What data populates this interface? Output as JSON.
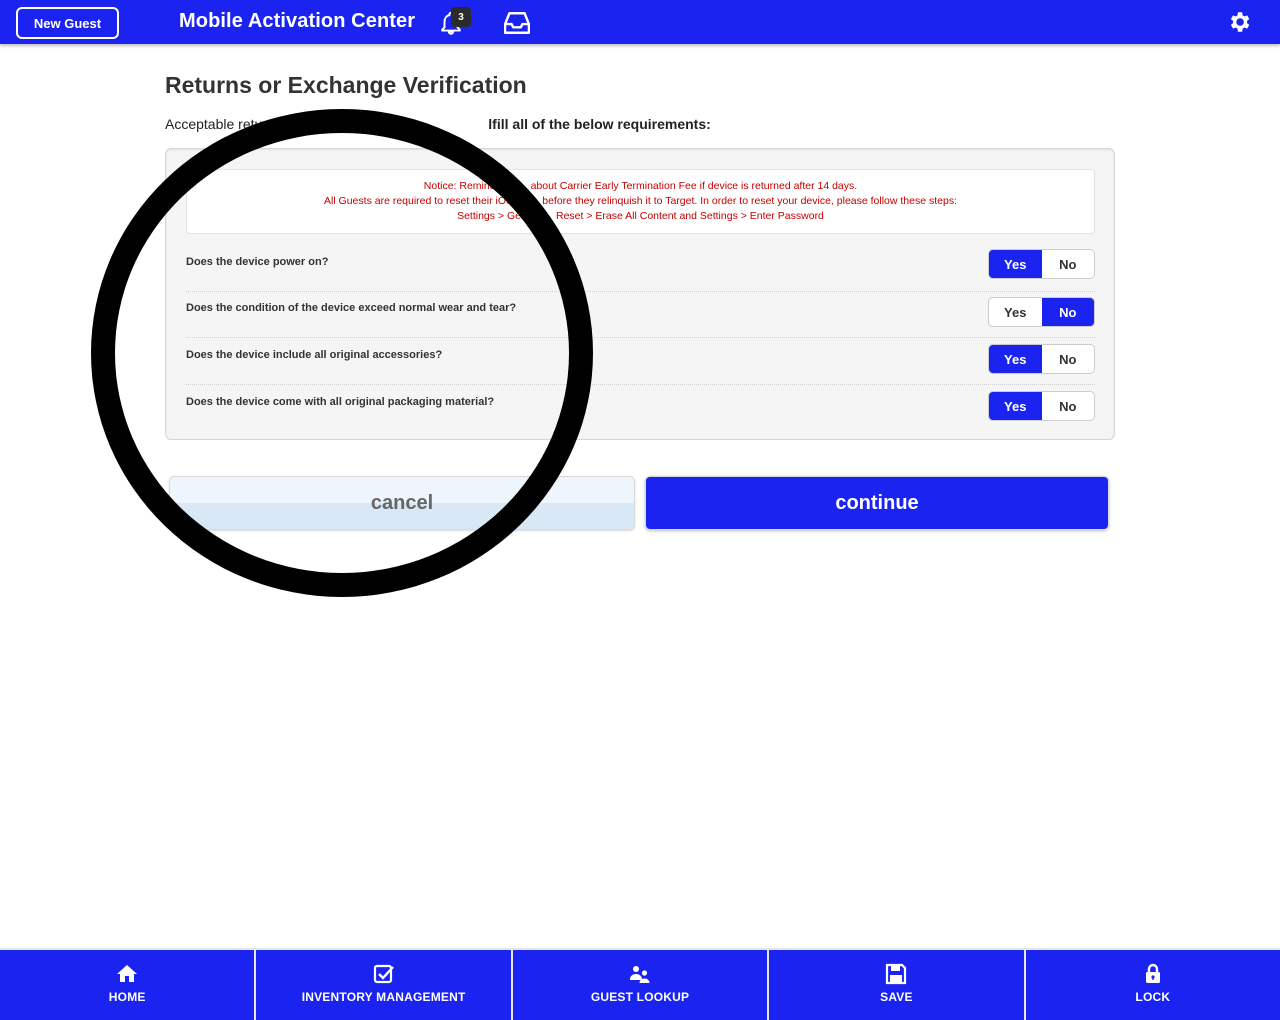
{
  "header": {
    "new_guest_label": "New Guest",
    "app_title": "Mobile Activation Center",
    "notification_count": "3",
    "icons": [
      "bell-icon",
      "inbox-icon",
      "gear-icon"
    ]
  },
  "main": {
    "title": "Returns or Exchange Verification",
    "intro_start": "Acceptable retu",
    "intro_bold": "lfill all of the below requirements:",
    "notice": {
      "line1": "Notice: Remind            about Carrier Early Termination Fee if device is returned after 14 days.",
      "line2": "All Guests are required to reset their iOS          before they relinquish it to Target. In order to reset your device, please follow these steps:",
      "line3": "Settings > Gen          Reset > Erase All Content and Settings > Enter Password"
    },
    "questions": [
      {
        "text": "Does the device power on?",
        "yes": "Yes",
        "no": "No",
        "selected": "Yes"
      },
      {
        "text": "Does the condition of the device exceed normal wear and tear?",
        "yes": "Yes",
        "no": "No",
        "selected": "No"
      },
      {
        "text": "Does the device include all original accessories?",
        "yes": "Yes",
        "no": "No",
        "selected": "Yes"
      },
      {
        "text": "Does the device come with all original packaging material?",
        "yes": "Yes",
        "no": "No",
        "selected": "Yes"
      }
    ],
    "cancel_label": "cancel",
    "continue_label": "continue"
  },
  "bottom_nav": [
    {
      "label": "HOME",
      "icon": "home-icon"
    },
    {
      "label": "INVENTORY MANAGEMENT",
      "icon": "checkbox-icon"
    },
    {
      "label": "GUEST LOOKUP",
      "icon": "users-icon"
    },
    {
      "label": "SAVE",
      "icon": "floppy-icon"
    },
    {
      "label": "LOCK",
      "icon": "lock-icon"
    }
  ],
  "colors": {
    "brand_blue": "#1a23f0",
    "notice_red": "#c40000"
  }
}
